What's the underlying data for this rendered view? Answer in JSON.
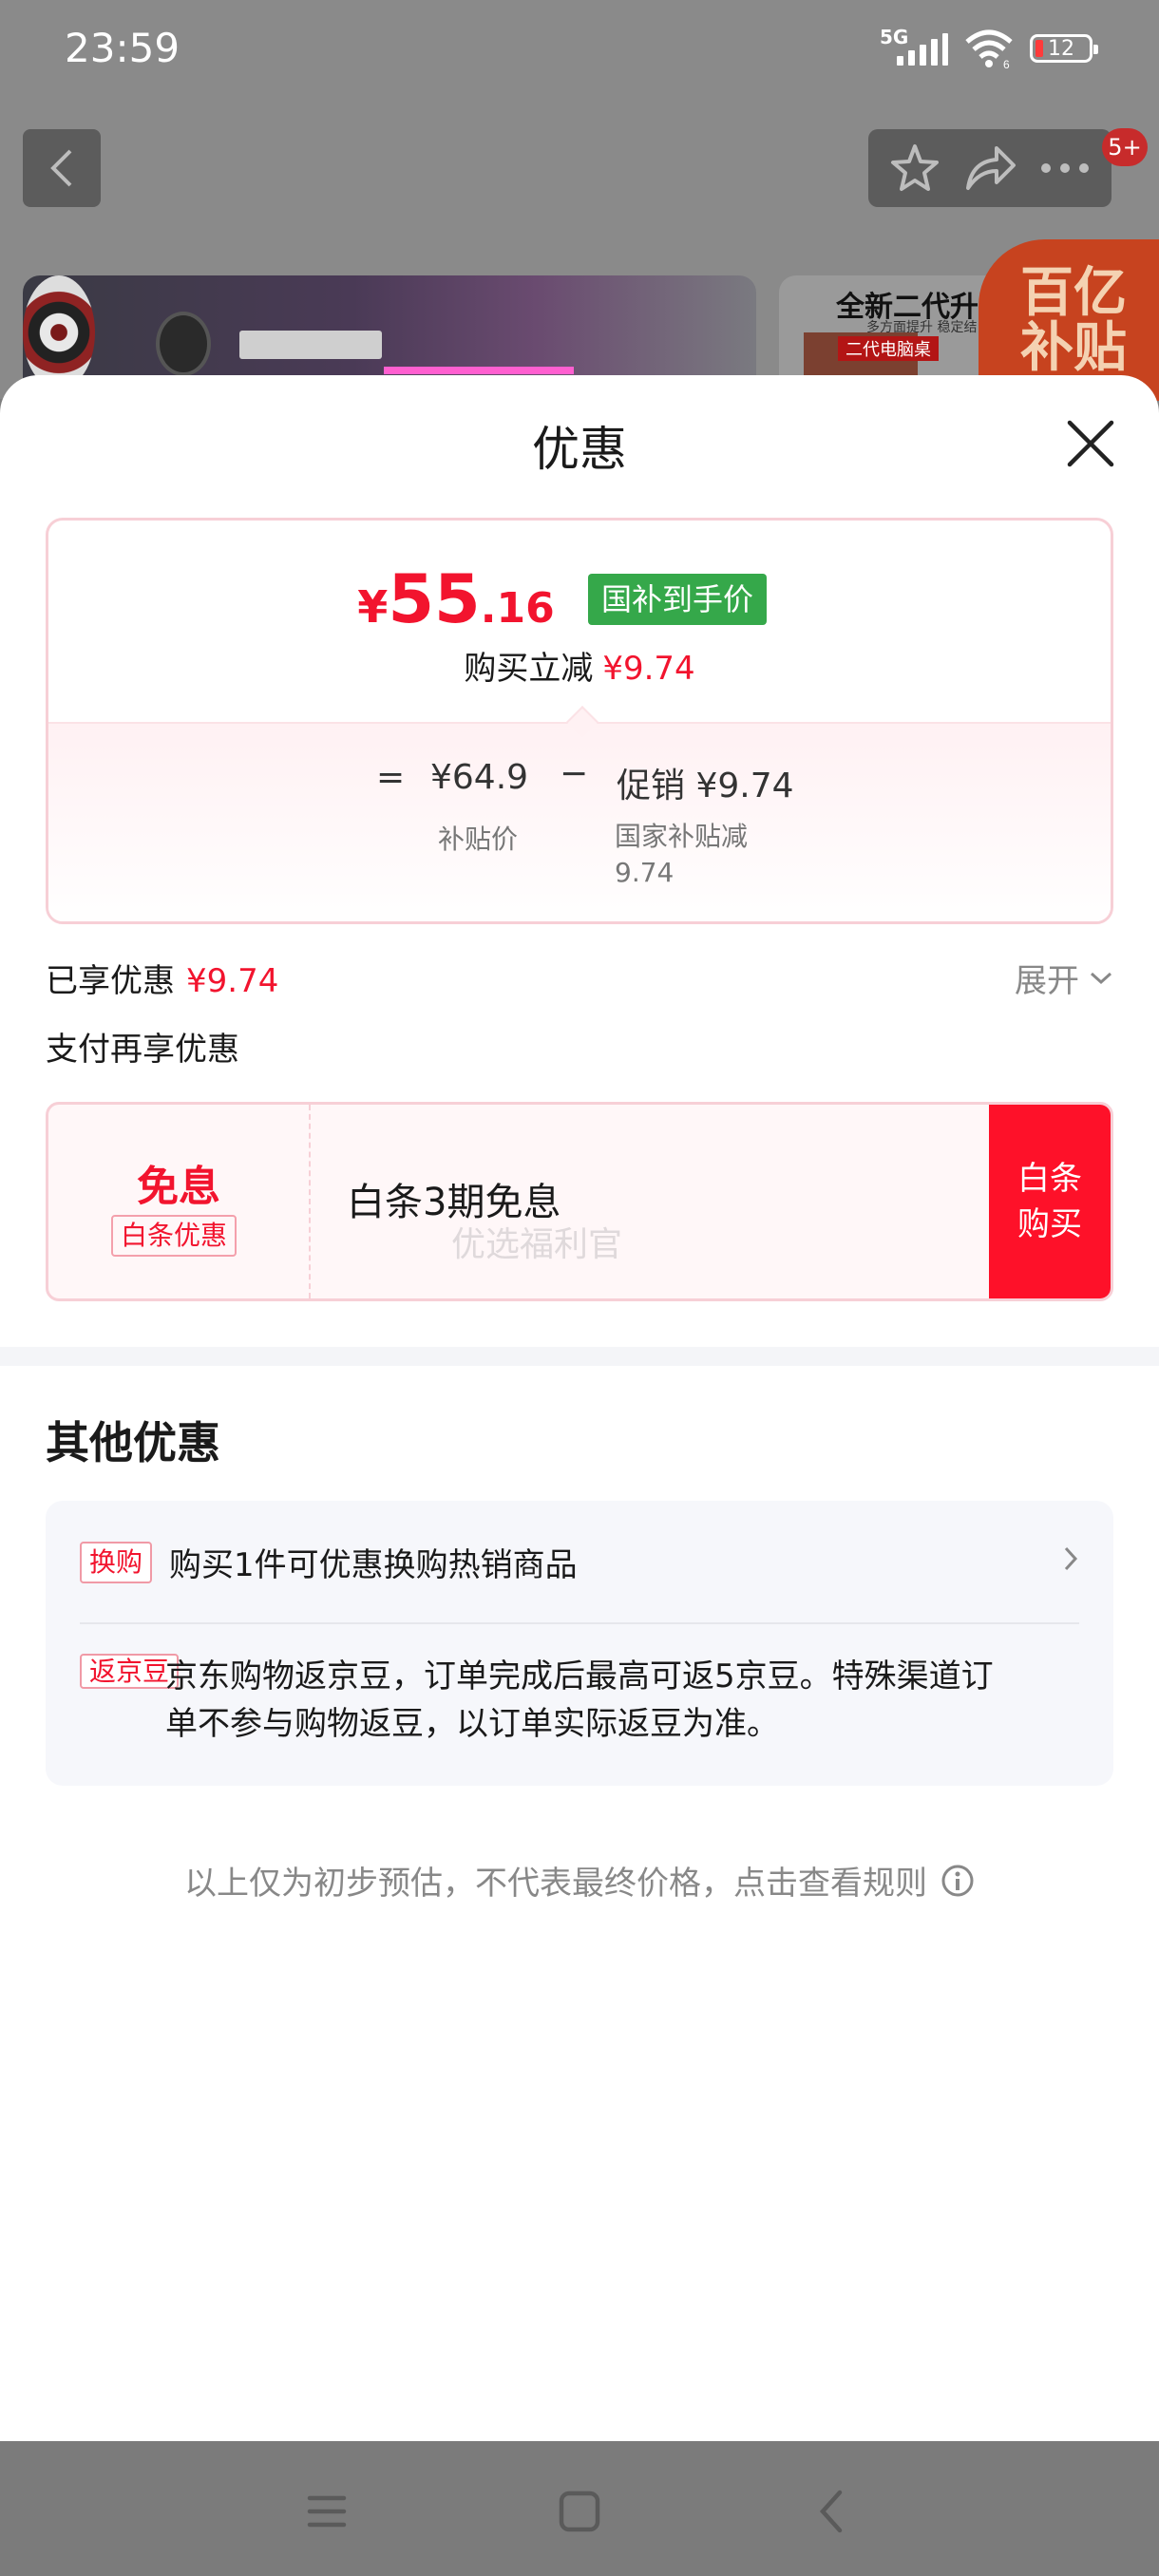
{
  "status_bar": {
    "time": "23:59",
    "network": "5G",
    "wifi_badge": "6",
    "battery": "12"
  },
  "background_page": {
    "cart_badge": "5+",
    "banner_right": {
      "title": "全新二代升",
      "subtitle": "多方面提升 稳定结",
      "tag": "二代电脑桌"
    },
    "subsidy_logo": [
      "百亿",
      "补贴"
    ]
  },
  "sheet": {
    "title": "优惠",
    "price_card": {
      "currency": "¥",
      "price_int": "55",
      "price_dec": ".16",
      "gov_tag": "国补到手价",
      "save_label": "购买立减",
      "save_value": "¥9.74",
      "formula": {
        "equals": "=",
        "subsidy_price": "¥64.9",
        "subsidy_label": "补贴价",
        "minus": "−",
        "promo": "促销 ¥9.74",
        "promo_label_1": "国家补贴减",
        "promo_label_2": "9.74"
      }
    },
    "enjoyed_label": "已享优惠",
    "enjoyed_value": "¥9.74",
    "expand_label": "展开",
    "pay_more_label": "支付再享优惠",
    "baitiao": {
      "free_label": "免息",
      "tag": "白条优惠",
      "text": "白条3期免息",
      "watermark": "优选福利官",
      "buy_line1": "白条",
      "buy_line2": "购买"
    },
    "other": {
      "title": "其他优惠",
      "items": [
        {
          "tag": "换购",
          "text": "购买1件可优惠换购热销商品"
        },
        {
          "tag": "返京豆",
          "text": "京东购物返京豆，订单完成后最高可返5京豆。特殊渠道订单不参与购物返豆，以订单实际返豆为准。"
        }
      ]
    },
    "disclaimer": "以上仅为初步预估，不代表最终价格，点击查看规则"
  },
  "colors": {
    "accent_red": "#f2142e",
    "gov_green": "#35a84a",
    "buy_red": "#fe1129"
  }
}
